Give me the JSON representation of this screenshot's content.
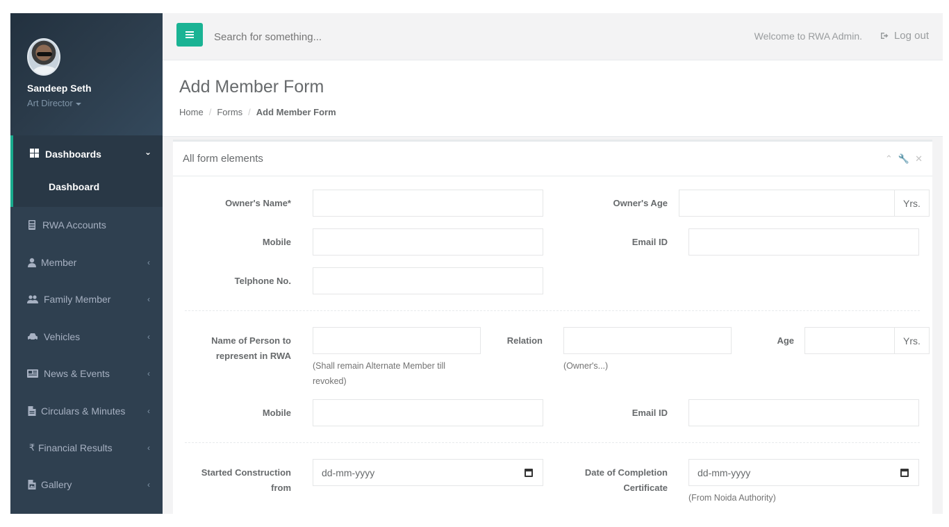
{
  "user": {
    "name": "Sandeep Seth",
    "role": "Art Director"
  },
  "nav": {
    "dashboards": "Dashboards",
    "dashboard_sub": "Dashboard",
    "items": [
      {
        "label": "RWA Accounts",
        "icon": "calculator-icon"
      },
      {
        "label": "Member",
        "icon": "user-icon"
      },
      {
        "label": "Family Member",
        "icon": "users-icon"
      },
      {
        "label": "Vehicles",
        "icon": "car-icon"
      },
      {
        "label": "News & Events",
        "icon": "newspaper-icon"
      },
      {
        "label": "Circulars & Minutes",
        "icon": "file-icon"
      },
      {
        "label": "Financial Results",
        "icon": "rupee-icon"
      },
      {
        "label": "Gallery",
        "icon": "image-file-icon"
      }
    ]
  },
  "topbar": {
    "search_placeholder": "Search for something...",
    "welcome": "Welcome to RWA Admin.",
    "logout": "Log out"
  },
  "page": {
    "title": "Add Member Form",
    "breadcrumb": [
      "Home",
      "Forms",
      "Add Member Form"
    ]
  },
  "panel": {
    "title": "All form elements"
  },
  "form": {
    "owner_name_label": "Owner's Name*",
    "owner_age_label": "Owner's Age",
    "yrs": "Yrs.",
    "mobile_label": "Mobile",
    "email_label": "Email ID",
    "telephone_label": "Telphone No.",
    "representative_label_1": "Name of Person to",
    "representative_label_2": "represent in RWA",
    "representative_help_1": "(Shall remain Alternate Member till",
    "representative_help_2": "revoked)",
    "relation_label": "Relation",
    "relation_help": "(Owner's...)",
    "age_label": "Age",
    "construction_label_1": "Started Construction",
    "construction_label_2": "from",
    "completion_label_1": "Date of Completion",
    "completion_label_2": "Certificate",
    "date_placeholder": "dd-mm-yyyy",
    "completion_help": "(From Noida Authority)"
  }
}
